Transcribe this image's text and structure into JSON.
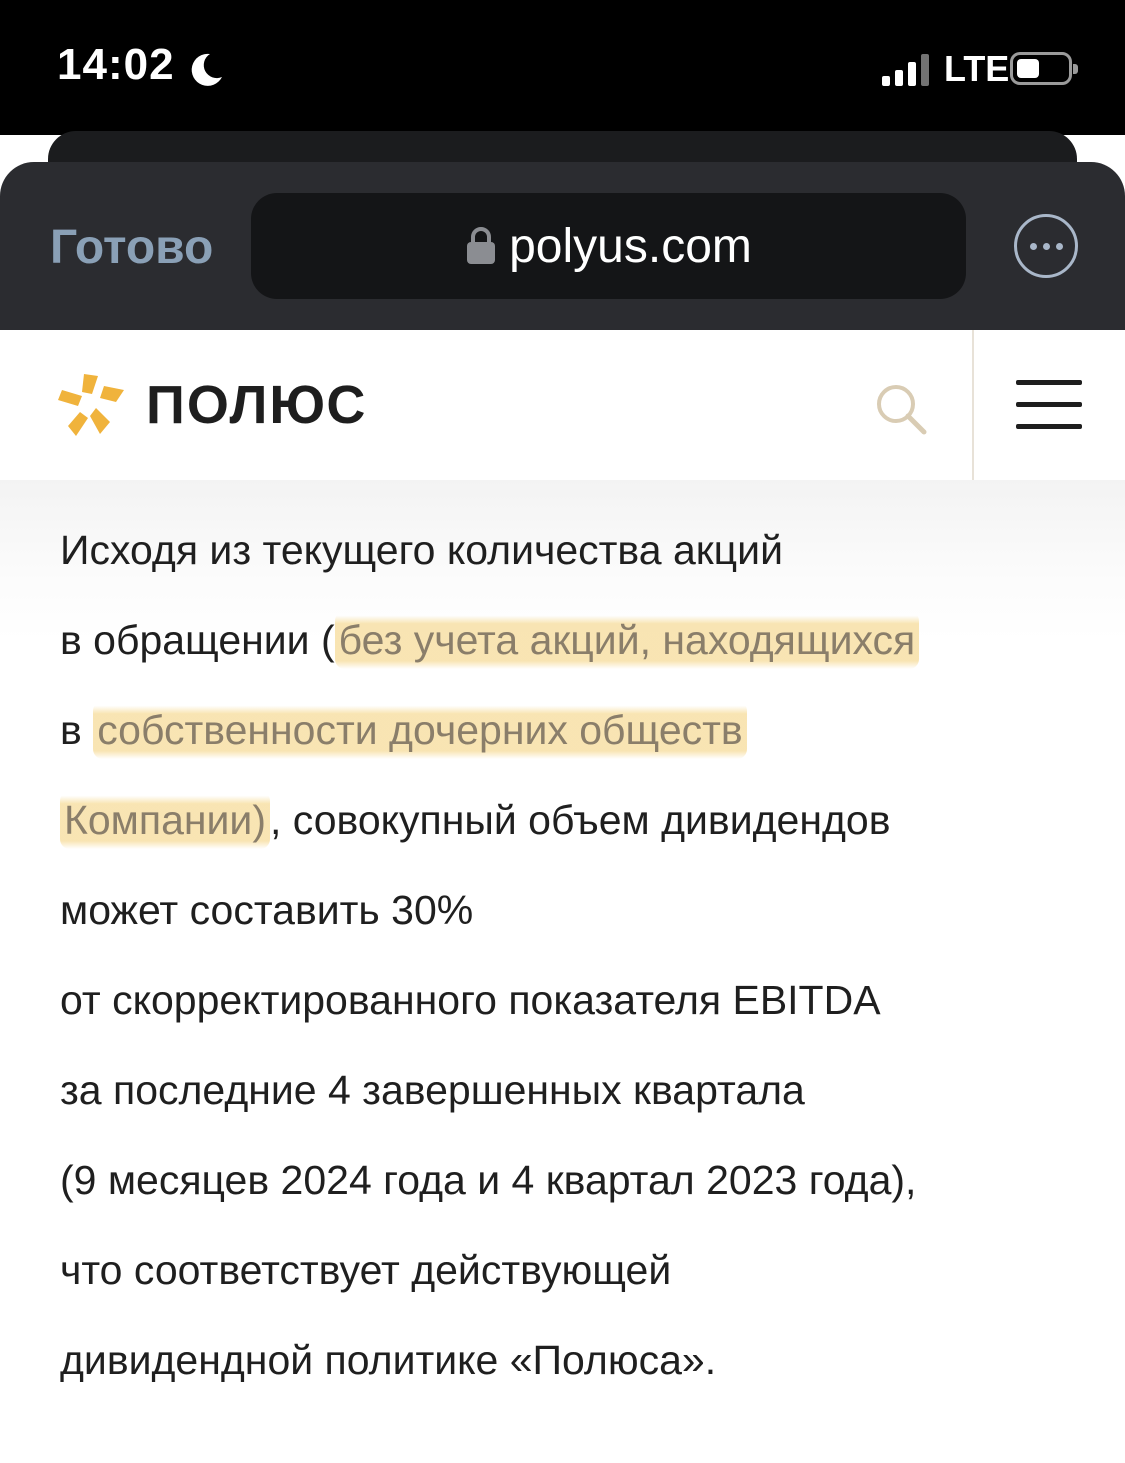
{
  "status_bar": {
    "time": "14:02",
    "network": "LTE",
    "icons": [
      "moon-icon",
      "signal-icon",
      "battery-icon"
    ]
  },
  "browser": {
    "done_label": "Готово",
    "url": "polyus.com",
    "icons": [
      "lock-icon",
      "more-icon"
    ]
  },
  "site_header": {
    "logo_text": "ПОЛЮС",
    "brand_color": "#f0b33c",
    "icons": [
      "logo-star-icon",
      "search-icon",
      "menu-icon"
    ]
  },
  "article": {
    "highlight_color": "#f7dea0",
    "lines": [
      {
        "parts": [
          "Исходя из текущего количества акций"
        ]
      },
      {
        "parts": [
          "в обращении (",
          "без учета акций, находящихся"
        ]
      },
      {
        "parts": [
          "в ",
          "собственности дочерних обществ"
        ]
      },
      {
        "parts": [
          "Компании)",
          ", совокупный объем дивидендов"
        ]
      },
      {
        "parts": [
          "может составить 30%"
        ]
      },
      {
        "parts": [
          "от скорректированного показателя EBITDA"
        ]
      },
      {
        "parts": [
          "за последние 4 завершенных квартала"
        ]
      },
      {
        "parts": [
          "(9 месяцев 2024 года и 4 квартал 2023 года),"
        ]
      },
      {
        "parts": [
          "что соответствует действующей"
        ]
      },
      {
        "parts": [
          "дивидендной политике «Полюса»."
        ]
      }
    ]
  }
}
